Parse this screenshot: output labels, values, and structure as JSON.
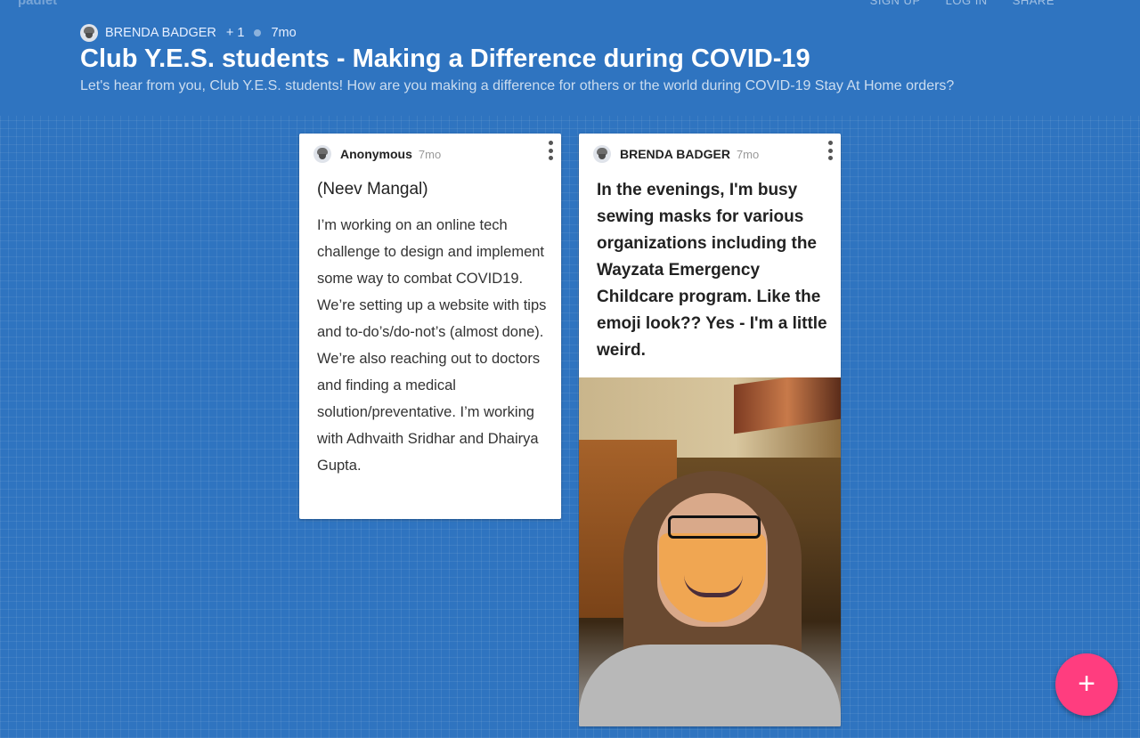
{
  "topbar": {
    "logo": "padlet",
    "nav": [
      "SIGN UP",
      "LOG IN",
      "SHARE"
    ]
  },
  "header": {
    "author": "BRENDA BADGER",
    "contributors": "+ 1",
    "age": "7mo",
    "title": "Club Y.E.S. students - Making a Difference during COVID-19",
    "description": "Let's hear from you, Club Y.E.S. students! How are you making a difference for others or the world during COVID-19 Stay At Home orders?"
  },
  "posts": [
    {
      "author": "Anonymous",
      "age": "7mo",
      "subject": "(Neev Mangal)",
      "body": "I’m working on an online tech challenge to design and implement some way to combat COVID19. We’re setting up a website with tips and to-do’s/do-not’s (almost done). We’re also reaching out to doctors and finding a medical solution/preventative. I’m working with Adhvaith Sridhar and Dhairya Gupta."
    },
    {
      "author": "BRENDA BADGER",
      "age": "7mo",
      "body": "In the evenings, I'm busy sewing masks for various organizations including the Wayzata Emergency Childcare program.  Like the emoji look??  Yes - I'm a little weird."
    }
  ],
  "fab": {
    "label": "+"
  },
  "colors": {
    "background": "#2f74c0",
    "fab": "#ff3d7f"
  }
}
